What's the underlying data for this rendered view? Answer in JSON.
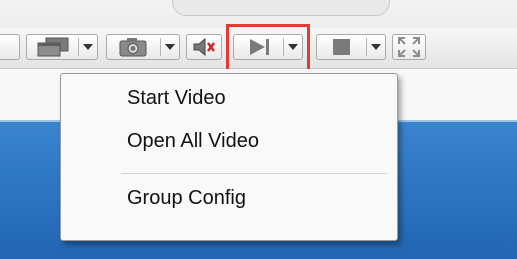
{
  "toolbar": {
    "buttons": [
      {
        "name": "window-layout",
        "icon": "window-stack-icon"
      },
      {
        "name": "snapshot",
        "icon": "camera-icon"
      },
      {
        "name": "audio",
        "icon": "speaker-mute-icon"
      },
      {
        "name": "play-video",
        "icon": "play-icon"
      },
      {
        "name": "stop-video",
        "icon": "stop-icon"
      },
      {
        "name": "fullscreen",
        "icon": "expand-icon"
      }
    ],
    "highlight_color": "#e53935"
  },
  "menu": {
    "items": [
      {
        "label": "Start Video"
      },
      {
        "label": "Open All Video"
      },
      {
        "label": "Group Config"
      }
    ]
  }
}
